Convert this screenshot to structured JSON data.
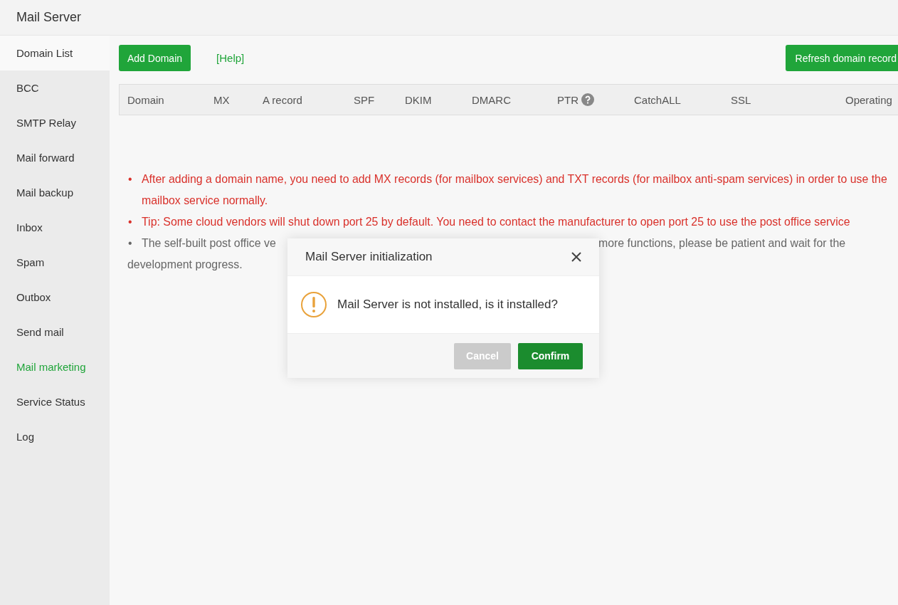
{
  "window": {
    "title": "Mail Server"
  },
  "sidebar": {
    "items": [
      {
        "label": "Domain List",
        "selected": true,
        "highlighted": false
      },
      {
        "label": "BCC",
        "selected": false,
        "highlighted": false
      },
      {
        "label": "SMTP Relay",
        "selected": false,
        "highlighted": false
      },
      {
        "label": "Mail forward",
        "selected": false,
        "highlighted": false
      },
      {
        "label": "Mail backup",
        "selected": false,
        "highlighted": false
      },
      {
        "label": "Inbox",
        "selected": false,
        "highlighted": false
      },
      {
        "label": "Spam",
        "selected": false,
        "highlighted": false
      },
      {
        "label": "Outbox",
        "selected": false,
        "highlighted": false
      },
      {
        "label": "Send mail",
        "selected": false,
        "highlighted": false
      },
      {
        "label": "Mail marketing",
        "selected": false,
        "highlighted": true
      },
      {
        "label": "Service Status",
        "selected": false,
        "highlighted": false
      },
      {
        "label": "Log",
        "selected": false,
        "highlighted": false
      }
    ]
  },
  "toolbar": {
    "add_button": "Add Domain",
    "help_link": "[Help]",
    "refresh_button": "Refresh domain record"
  },
  "table": {
    "columns": [
      {
        "label": "Domain",
        "help": false
      },
      {
        "label": "MX",
        "help": false
      },
      {
        "label": "A record",
        "help": false
      },
      {
        "label": "SPF",
        "help": false
      },
      {
        "label": "DKIM",
        "help": false
      },
      {
        "label": "DMARC",
        "help": false
      },
      {
        "label": "PTR",
        "help": true
      },
      {
        "label": "CatchALL",
        "help": false
      },
      {
        "label": "SSL",
        "help": false
      },
      {
        "label": "Operating",
        "help": false
      }
    ]
  },
  "notes": [
    {
      "bullet": "•",
      "fragments": [
        "After adding a domain name, you need to add MX records (for mailbox services) and TXT records (for mailbox anti-spam services) in order to use the mailbox service normally."
      ],
      "kind": "warning"
    },
    {
      "bullet": "•",
      "fragments": [
        "Tip: Some cloud vendors will shut down port 25 by default. You need to contact the manufacturer to open port 25 to use the post office service"
      ],
      "kind": "warning"
    },
    {
      "bullet": "•",
      "fragments": [
        "The self-built post office ve",
        "more functions, please be patient and wait for the",
        "development progress."
      ],
      "kind": "info"
    }
  ],
  "dialog": {
    "title": "Mail Server initialization",
    "message": "Mail Server is not installed, is it installed?",
    "buttons": [
      {
        "label": "Cancel",
        "kind": "secondary"
      },
      {
        "label": "Confirm",
        "kind": "primary"
      }
    ]
  }
}
